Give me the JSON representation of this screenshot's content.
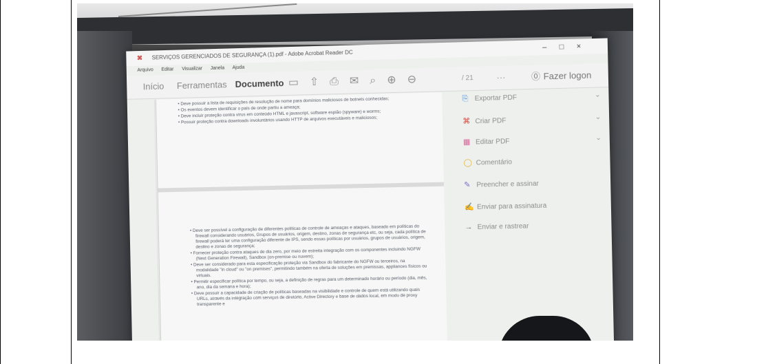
{
  "window": {
    "title": "SERVIÇOS GERENCIADOS DE SEGURANÇA (1).pdf - Adobe Acrobat Reader DC",
    "controls": [
      "–",
      "□",
      "×"
    ]
  },
  "menu": [
    "Arquivo",
    "Editar",
    "Visualizar",
    "Janela",
    "Ajuda"
  ],
  "tabs": [
    "Início",
    "Ferramentas",
    "Documento"
  ],
  "active_tab": "Documento",
  "page_indicator": "/ 21",
  "logon_label": "Fazer logon",
  "side_panel": [
    {
      "label": "Exportar PDF",
      "icon": "export-pdf-icon",
      "chevron": true
    },
    {
      "label": "Criar PDF",
      "icon": "create-pdf-icon",
      "chevron": true
    },
    {
      "label": "Editar PDF",
      "icon": "edit-pdf-icon",
      "chevron": true
    },
    {
      "label": "Comentário",
      "icon": "comment-icon",
      "chevron": false
    },
    {
      "label": "Preencher e assinar",
      "icon": "fill-sign-icon",
      "chevron": false
    },
    {
      "label": "Enviar para assinatura",
      "icon": "send-signature-icon",
      "chevron": false
    },
    {
      "label": "Enviar e rastrear",
      "icon": "send-track-icon",
      "chevron": false
    }
  ],
  "page1_bullets": [
    "Deve possuir a lista de requisições de resolução de nome para domínios maliciosos de botnets conhecidas;",
    "Os eventos devem identificar o país de onde partiu a ameaça;",
    "Deve incluir proteção contra vírus em conteúdo HTML e javascript, software espião (spyware) e worms;",
    "Possuir proteção contra downloads involuntários usando HTTP de arquivos executáveis e maliciosos;"
  ],
  "page2_bullets": [
    "Deve ser possível a configuração de diferentes políticas de controle de ameaças e ataques, baseado em políticas do firewall considerando usuários, Grupos de usuários, origem, destino, zonas de segurança etc, ou seja, cada política de firewall poderá ter uma configuração diferente de IPS, sendo essas políticas por usuários, grupos de usuários, origem, destino e zonas de segurança;",
    "Fornecer proteção contra ataques de dia zero, por meio de estreita integração com os componentes incluindo NGFW (Next Generation Firewall), Sandbox (on-premise ou nuvem);",
    "Deve ser considerado para esta especificação proteção via Sandbox do fabricante do NGFW ou terceiros, na modalidade \"in cloud\" ou \"on premises\", permitindo também na oferta de soluções em premissas, appliances físicos ou virtuais.",
    "Permitir especificar política por tempo, ou seja, a definição de regras para um determinado horário ou período (dia, mês, ano, dia da semana e hora);",
    "Deve possuir a capacidade de criação de políticas baseadas na visibilidade e controle de quem está utilizando quais URLs, através da integração com serviços de diretório, Active Directory e base de dados local, em modo de proxy transparente e"
  ]
}
